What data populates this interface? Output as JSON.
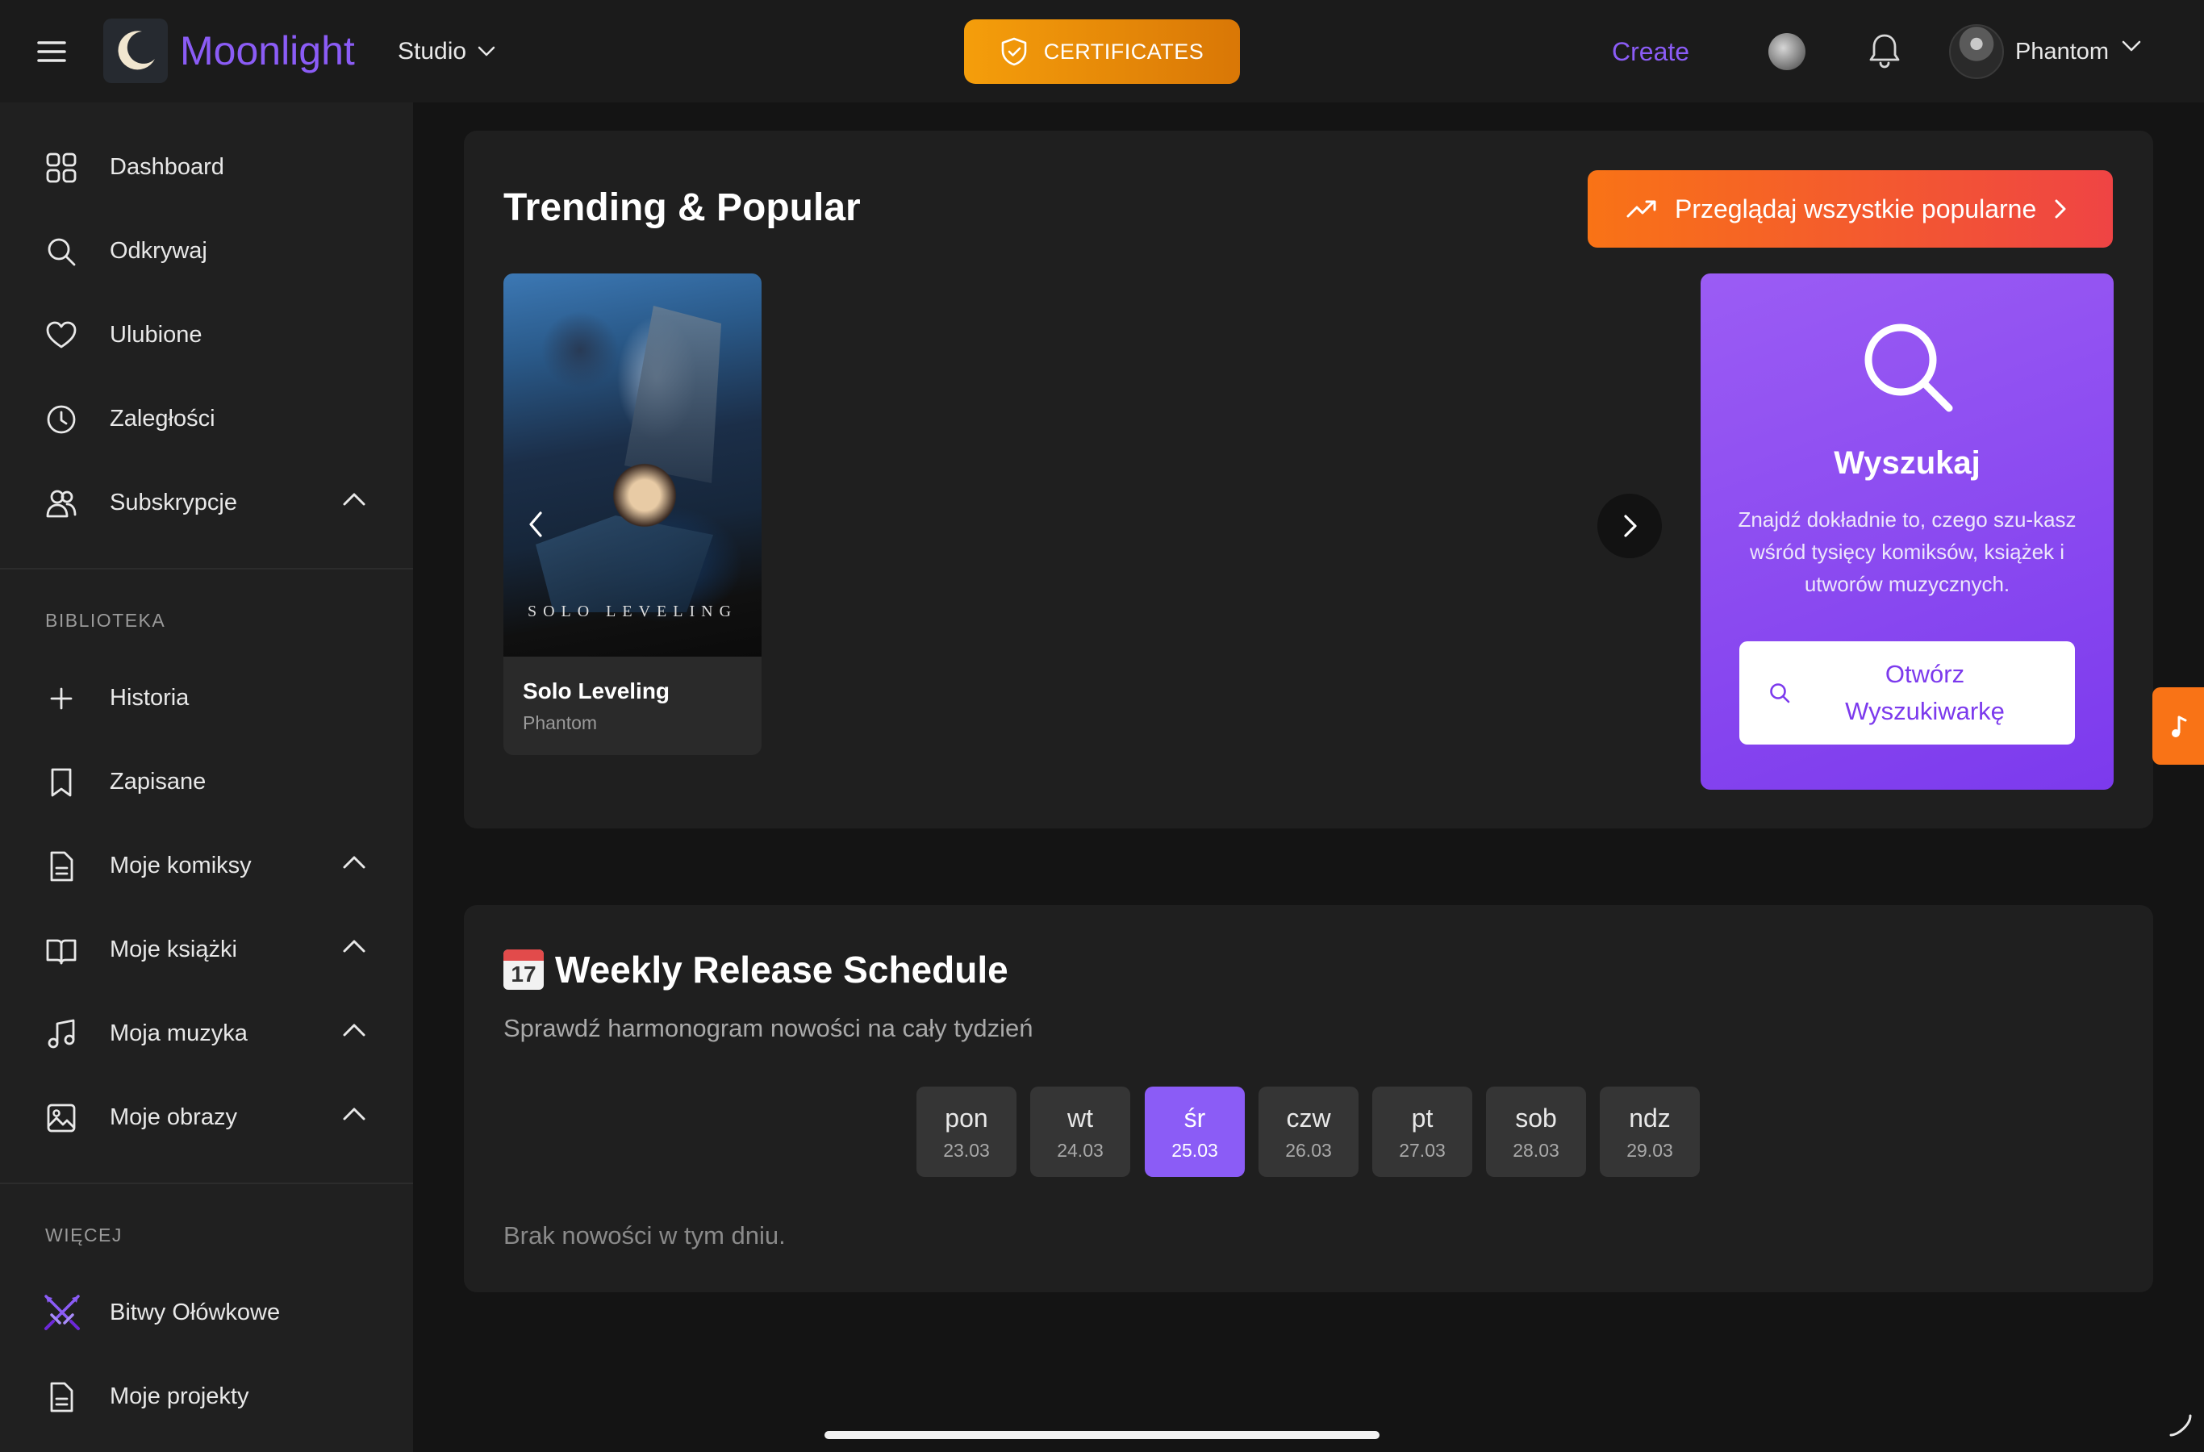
{
  "header": {
    "brand": "Moonlight",
    "studio_label": "Studio",
    "certificates_label": "CERTIFICATES",
    "create_label": "Create",
    "user_name": "Phantom"
  },
  "sidebar": {
    "main_items": [
      {
        "label": "Dashboard",
        "icon": "grid-icon"
      },
      {
        "label": "Odkrywaj",
        "icon": "search-icon"
      },
      {
        "label": "Ulubione",
        "icon": "heart-icon"
      },
      {
        "label": "Zaległości",
        "icon": "clock-icon"
      },
      {
        "label": "Subskrypcje",
        "icon": "users-icon"
      }
    ],
    "library_title": "BIBLIOTEKA",
    "library_items": [
      {
        "label": "Historia",
        "icon": "plus-icon"
      },
      {
        "label": "Zapisane",
        "icon": "bookmark-icon"
      },
      {
        "label": "Moje komiksy",
        "icon": "document-icon"
      },
      {
        "label": "Moje książki",
        "icon": "book-icon"
      },
      {
        "label": "Moja muzyka",
        "icon": "music-icon"
      },
      {
        "label": "Moje obrazy",
        "icon": "image-icon"
      }
    ],
    "more_title": "WIĘCEJ",
    "more_items": [
      {
        "label": "Bitwy Ołówkowe",
        "icon": "crossed-swords-icon"
      },
      {
        "label": "Moje projekty",
        "icon": "document-icon"
      }
    ]
  },
  "trending": {
    "title": "Trending & Popular",
    "browse_label": "Przeglądaj wszystkie popularne",
    "card": {
      "cover_text": "SOLO LEVELING",
      "title": "Solo Leveling",
      "author": "Phantom"
    },
    "search_card": {
      "title": "Wyszukaj",
      "description": "Znajdź dokładnie to, czego szu-kasz wśród tysięcy komiksów, książek i utworów muzycznych.",
      "button_label": "Otwórz Wyszukiwarkę"
    }
  },
  "schedule": {
    "icon_day": "17",
    "title": "Weekly Release Schedule",
    "subtitle": "Sprawdź harmonogram nowości na cały tydzień",
    "days": [
      {
        "name": "pon",
        "date": "23.03",
        "active": false
      },
      {
        "name": "wt",
        "date": "24.03",
        "active": false
      },
      {
        "name": "śr",
        "date": "25.03",
        "active": true
      },
      {
        "name": "czw",
        "date": "26.03",
        "active": false
      },
      {
        "name": "pt",
        "date": "27.03",
        "active": false
      },
      {
        "name": "sob",
        "date": "28.03",
        "active": false
      },
      {
        "name": "ndz",
        "date": "29.03",
        "active": false
      }
    ],
    "empty_message": "Brak nowości w tym dniu."
  },
  "colors": {
    "accent": "#8b5cf6",
    "certificate_orange": "#f59e0b",
    "browse_gradient_start": "#f97316",
    "browse_gradient_end": "#ef4444"
  }
}
